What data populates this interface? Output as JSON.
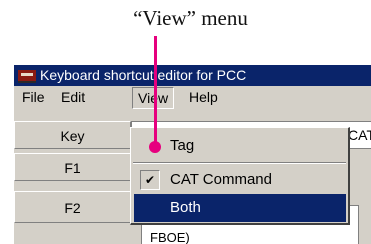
{
  "callout": {
    "text": "“View” menu"
  },
  "window": {
    "title": "Keyboard shortcut editor for PCC"
  },
  "menubar": {
    "file": "File",
    "edit": "Edit",
    "view": "View",
    "help": "Help"
  },
  "grid": {
    "key_header": "Key",
    "f1": "F1",
    "f2": "F2",
    "top_cell": "CAT",
    "bottom_cell": "FBOE)"
  },
  "view_menu": {
    "items": [
      {
        "label": "Tag",
        "checked": false,
        "highlighted": false
      },
      {
        "label": "CAT Command",
        "checked": true,
        "highlighted": false
      },
      {
        "label": "Both",
        "checked": false,
        "highlighted": true
      }
    ],
    "check_mark": "✔"
  },
  "colors": {
    "title_bar": "#0a246a",
    "highlight": "#0a246a",
    "pointer": "#e6007e",
    "face": "#d4d0c8"
  }
}
